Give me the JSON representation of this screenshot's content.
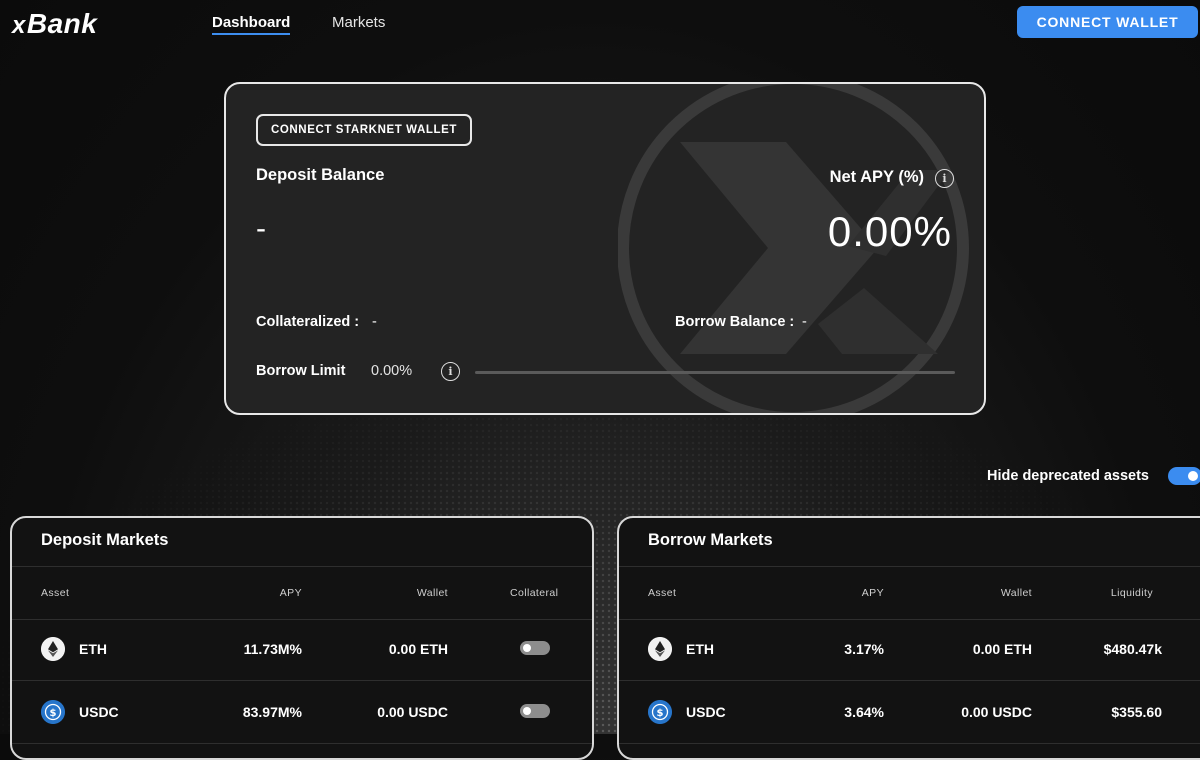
{
  "header": {
    "logo_x": "x",
    "logo_text": "Bank",
    "nav": [
      {
        "label": "Dashboard",
        "active": true
      },
      {
        "label": "Markets",
        "active": false
      }
    ],
    "connect_wallet_label": "CONNECT WALLET"
  },
  "summary": {
    "starknet_button": "CONNECT STARKNET WALLET",
    "deposit_balance_label": "Deposit Balance",
    "deposit_balance_value": "-",
    "net_apy_label": "Net APY (%)",
    "net_apy_value": "0.00%",
    "collateralized_label": "Collateralized :",
    "collateralized_value": "-",
    "borrow_balance_label": "Borrow Balance :",
    "borrow_balance_value": "-",
    "borrow_limit_label": "Borrow Limit",
    "borrow_limit_value": "0.00%",
    "borrow_limit_fraction": 0
  },
  "filters": {
    "hide_deprecated_label": "Hide deprecated assets",
    "hide_deprecated_on": true
  },
  "deposit_markets": {
    "title": "Deposit Markets",
    "columns": [
      "Asset",
      "APY",
      "Wallet",
      "Collateral"
    ],
    "rows": [
      {
        "asset": "ETH",
        "icon": "eth-icon",
        "apy": "11.73M%",
        "wallet": "0.00 ETH",
        "collateral": false
      },
      {
        "asset": "USDC",
        "icon": "usdc-icon",
        "apy": "83.97M%",
        "wallet": "0.00 USDC",
        "collateral": false
      }
    ]
  },
  "borrow_markets": {
    "title": "Borrow Markets",
    "columns": [
      "Asset",
      "APY",
      "Wallet",
      "Liquidity"
    ],
    "rows": [
      {
        "asset": "ETH",
        "icon": "eth-icon",
        "apy": "3.17%",
        "wallet": "0.00 ETH",
        "liquidity": "$480.47k"
      },
      {
        "asset": "USDC",
        "icon": "usdc-icon",
        "apy": "3.64%",
        "wallet": "0.00 USDC",
        "liquidity": "$355.60"
      }
    ]
  },
  "colors": {
    "accent": "#3b8cf0",
    "background": "#0e0e0e",
    "card": "#232323",
    "usdc": "#2775ca"
  }
}
